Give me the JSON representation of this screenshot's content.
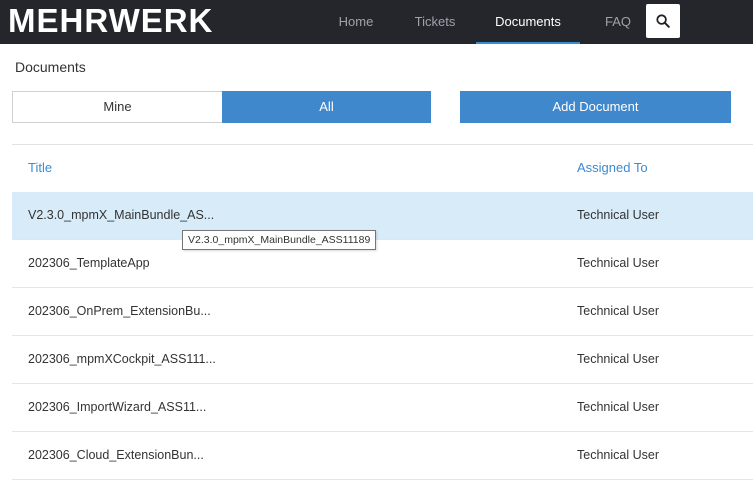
{
  "brand": "MEHRWERK",
  "nav": {
    "items": [
      {
        "label": "Home"
      },
      {
        "label": "Tickets"
      },
      {
        "label": "Documents"
      },
      {
        "label": "FAQ"
      }
    ],
    "active": "Documents",
    "search_icon": "search-icon"
  },
  "page": {
    "title": "Documents"
  },
  "filter": {
    "mine_label": "Mine",
    "all_label": "All",
    "selected": "All"
  },
  "actions": {
    "add_label": "Add Document"
  },
  "table": {
    "columns": {
      "title": "Title",
      "assigned": "Assigned To"
    },
    "rows": [
      {
        "title": "V2.3.0_mpmX_MainBundle_AS...",
        "assigned": "Technical User"
      },
      {
        "title": "202306_TemplateApp",
        "assigned": "Technical User"
      },
      {
        "title": "202306_OnPrem_ExtensionBu...",
        "assigned": "Technical User"
      },
      {
        "title": "202306_mpmXCockpit_ASS111...",
        "assigned": "Technical User"
      },
      {
        "title": "202306_ImportWizard_ASS11...",
        "assigned": "Technical User"
      },
      {
        "title": "202306_Cloud_ExtensionBun...",
        "assigned": "Technical User"
      }
    ]
  },
  "tooltip": {
    "text": "V2.3.0_mpmX_MainBundle_ASS11189"
  },
  "colors": {
    "navbar": "#24262b",
    "accent": "#3f88cc",
    "link": "#3d8ad0",
    "selected_row": "#d7ebf8"
  }
}
